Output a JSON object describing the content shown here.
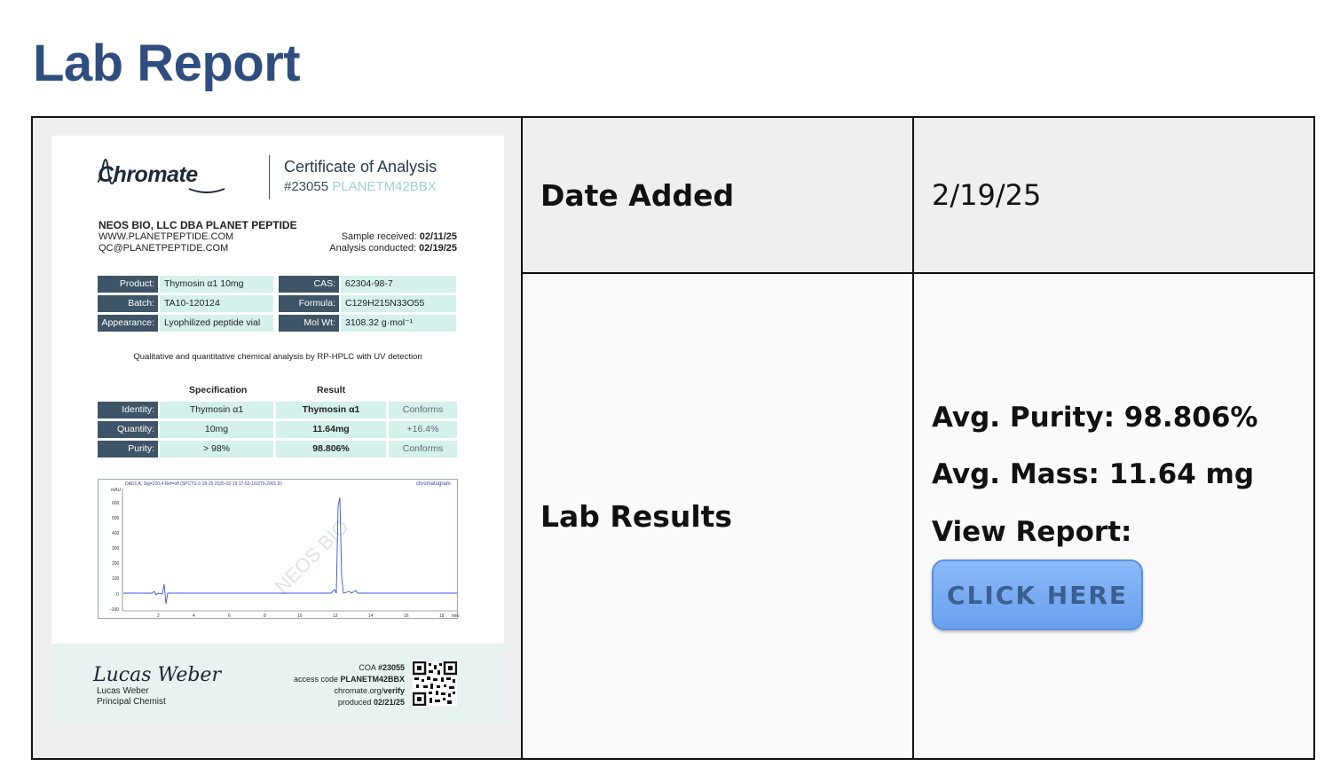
{
  "page": {
    "title": "Lab Report"
  },
  "table": {
    "date_label": "Date Added",
    "date_value": "2/19/25",
    "results_label": "Lab Results",
    "avg_purity": "Avg. Purity: 98.806%",
    "avg_mass": "Avg. Mass: 11.64 mg",
    "view_report": "View Report:",
    "button_label": "CLICK HERE"
  },
  "coa": {
    "brand": "Chromate",
    "title": "Certificate of Analysis",
    "number": "#23055",
    "code": "PLANETM42BBX",
    "company": "NEOS BIO, LLC DBA PLANET PEPTIDE",
    "website": "WWW.PLANETPEPTIDE.COM",
    "email": "QC@PLANETPEPTIDE.COM",
    "sample_received_label": "Sample received:",
    "sample_received": "02/11/25",
    "analysis_label": "Analysis conducted:",
    "analysis_date": "02/19/25",
    "fields_left": [
      {
        "key": "Product:",
        "value": "Thymosin α1 10mg"
      },
      {
        "key": "Batch:",
        "value": "TA10-120124"
      },
      {
        "key": "Appearance:",
        "value": "Lyophilized peptide vial"
      }
    ],
    "fields_right": [
      {
        "key": "CAS:",
        "value": "62304-98-7"
      },
      {
        "key": "Formula:",
        "value": "C129H215N33O55"
      },
      {
        "key": "Mol Wt:",
        "value": "3108.32 g·mol⁻¹"
      }
    ],
    "method": "Qualitative and quantitative chemical analysis by RP-HPLC with UV detection",
    "spec_header": "Specification",
    "result_header": "Result",
    "spec_rows": [
      {
        "key": "Identity:",
        "spec": "Thymosin α1",
        "result": "Thymosin α1",
        "status": "Conforms"
      },
      {
        "key": "Quantity:",
        "spec": "10mg",
        "result": "11.64mg",
        "status": "+16.4%"
      },
      {
        "key": "Purity:",
        "spec": "> 98%",
        "result": "98.806%",
        "status": "Conforms"
      }
    ],
    "chrom_title": "DAD1 A, Sig=220,4 Ref=off (SPCTS-2-18-25 2025-02-19 17-52-16\\270-2001.D)",
    "chrom_tag": "chromatogram",
    "chrom_yunit": "mAU",
    "chrom_yticks": [
      "600",
      "500",
      "400",
      "300",
      "200",
      "100",
      "0",
      "-100"
    ],
    "chrom_xticks": [
      "2",
      "4",
      "6",
      "8",
      "10",
      "12",
      "14",
      "16",
      "18"
    ],
    "chrom_xunit": "min",
    "watermark": "NEOS BIO",
    "signature": "Lucas Weber",
    "signer_name": "Lucas Weber",
    "signer_title": "Principal Chemist",
    "footer_coa_label": "COA",
    "footer_coa_num": "#23055",
    "footer_access_label": "access code",
    "footer_access_code": "PLANETM42BBX",
    "footer_verify_prefix": "chromate.org/",
    "footer_verify": "verify",
    "footer_produced_label": "produced",
    "footer_produced": "02/21/25"
  }
}
